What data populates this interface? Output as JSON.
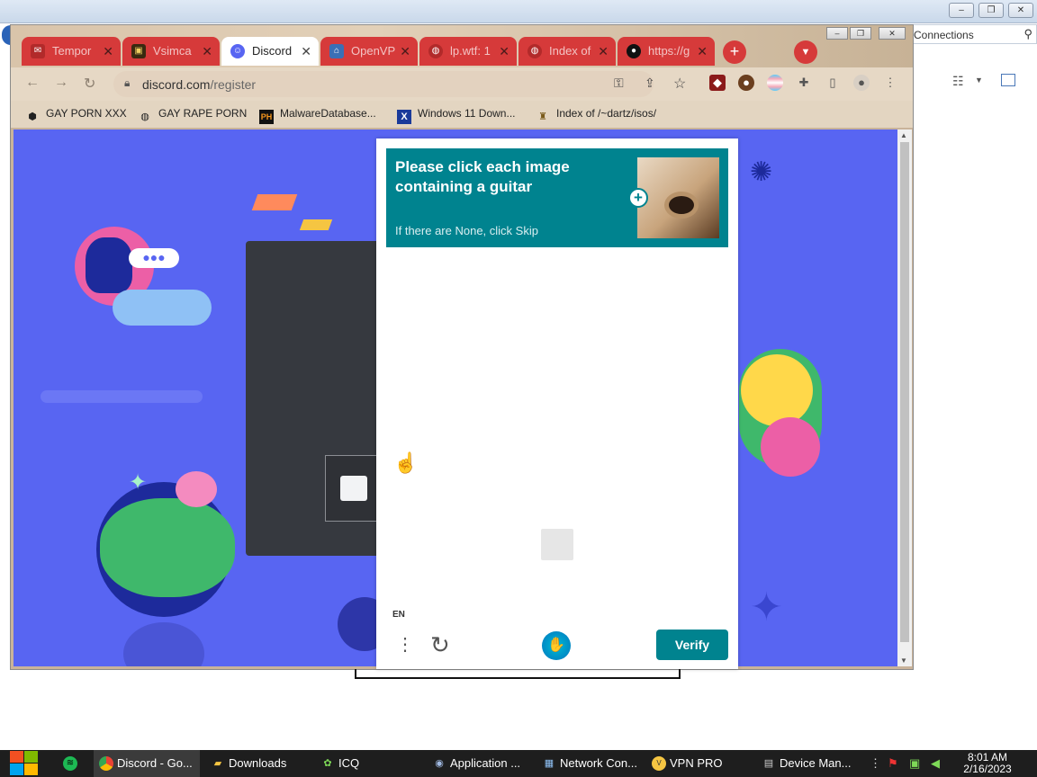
{
  "desktop": {
    "address_text": "Connections",
    "window_controls": [
      "–",
      "❐",
      "✕"
    ]
  },
  "browser": {
    "tabs": [
      {
        "label": "Tempor",
        "icon": "mail-icon",
        "active": false
      },
      {
        "label": "Vsimca",
        "icon": "chip-icon",
        "active": false
      },
      {
        "label": "Discord",
        "icon": "discord-icon",
        "active": true
      },
      {
        "label": "OpenVP",
        "icon": "openvpn-icon",
        "active": false
      },
      {
        "label": "lp.wtf: 1",
        "icon": "globe-icon",
        "active": false
      },
      {
        "label": "Index of",
        "icon": "globe-icon",
        "active": false
      },
      {
        "label": "https://g",
        "icon": "github-icon",
        "active": false
      }
    ],
    "url": {
      "host": "discord.com",
      "path": "/register"
    },
    "bookmarks": [
      {
        "label": "GAY PORN XXX",
        "icon": "badge-icon"
      },
      {
        "label": "GAY RAPE PORN",
        "icon": "globe-icon"
      },
      {
        "label": "MalwareDatabase...",
        "icon": "ph-icon",
        "icon_text": "PH"
      },
      {
        "label": "Windows 11 Down...",
        "icon": "x-icon",
        "icon_text": "X"
      },
      {
        "label": "Index of /~dartz/isos/",
        "icon": "person-icon"
      }
    ],
    "window_controls": [
      "–",
      "❐",
      "✕"
    ]
  },
  "captcha": {
    "prompt": "Please click each image containing a guitar",
    "hint": "If there are None, click Skip",
    "language": "EN",
    "verify_label": "Verify",
    "accent": "#00838f"
  },
  "page": {
    "background": "#5865f2"
  },
  "taskbar": {
    "items": [
      {
        "label": "Discord - Go...",
        "icon": "chrome-icon",
        "active": true
      },
      {
        "label": "Downloads",
        "icon": "folder-icon",
        "active": false
      },
      {
        "label": "ICQ",
        "icon": "icq-icon",
        "active": false
      },
      {
        "label": "Application ...",
        "icon": "app-icon",
        "active": false
      },
      {
        "label": "Network Con...",
        "icon": "network-icon",
        "active": false
      },
      {
        "label": "VPN PRO",
        "icon": "vpn-icon",
        "active": false
      },
      {
        "label": "Device Man...",
        "icon": "device-icon",
        "active": false
      }
    ],
    "time": "8:01 AM",
    "date": "2/16/2023"
  }
}
